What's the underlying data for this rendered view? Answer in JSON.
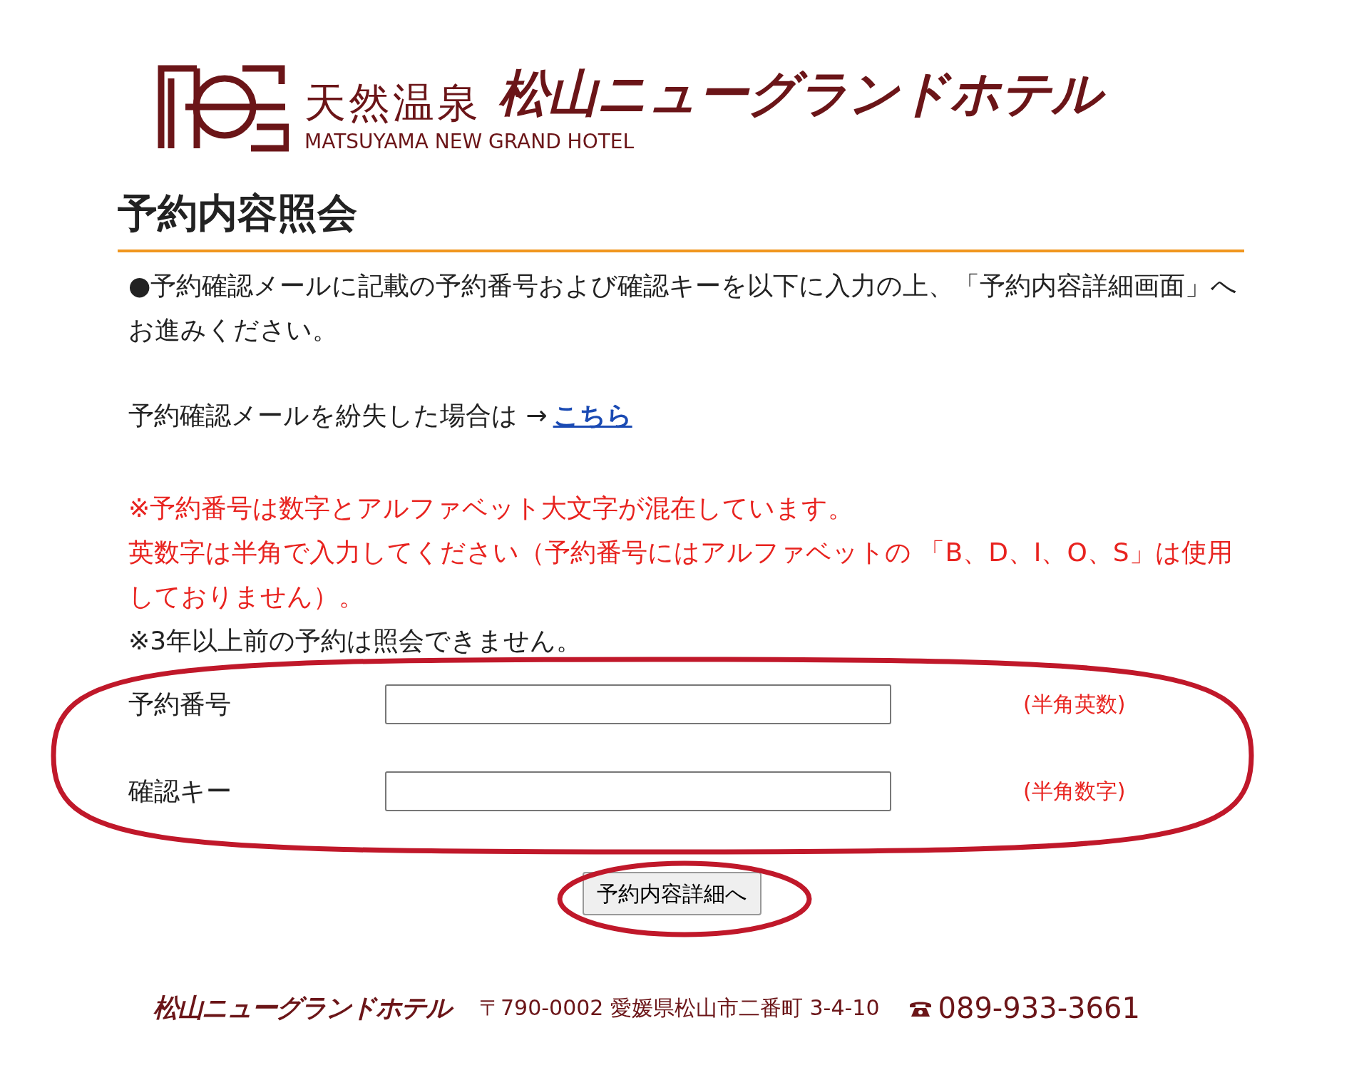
{
  "logo": {
    "tagline": "天然温泉",
    "name": "松山ニューグランドホテル",
    "english": "MATSUYAMA NEW GRAND HOTEL"
  },
  "heading": "予約内容照会",
  "intro": "●予約確認メールに記載の予約番号および確認キーを以下に入力の上、「予約内容詳細画面」へお進みください。",
  "lost_mail": {
    "text": "予約確認メールを紛失した場合は →",
    "link": "こちら"
  },
  "notes": [
    {
      "kind": "warning",
      "text": "※予約番号は数字とアルファベット大文字が混在しています。"
    },
    {
      "kind": "warning",
      "text": "英数字は半角で入力してください（予約番号にはアルファベットの 「B、D、I、O、S」は使用しておりません）。"
    },
    {
      "kind": "plain",
      "text": "※3年以上前の予約は照会できません。"
    }
  ],
  "fields": [
    {
      "label": "予約番号",
      "hint": "(半角英数)"
    },
    {
      "label": "確認キー",
      "hint": "(半角数字)"
    }
  ],
  "submit": "予約内容詳細へ",
  "footer": {
    "name": "松山ニューグランドホテル",
    "address": "〒790-0002 愛媛県松山市二番町 3-4-10",
    "phone": "089-933-3661"
  },
  "annotations": [
    {
      "kind": "ellipse"
    },
    {
      "kind": "ellipse"
    }
  ]
}
